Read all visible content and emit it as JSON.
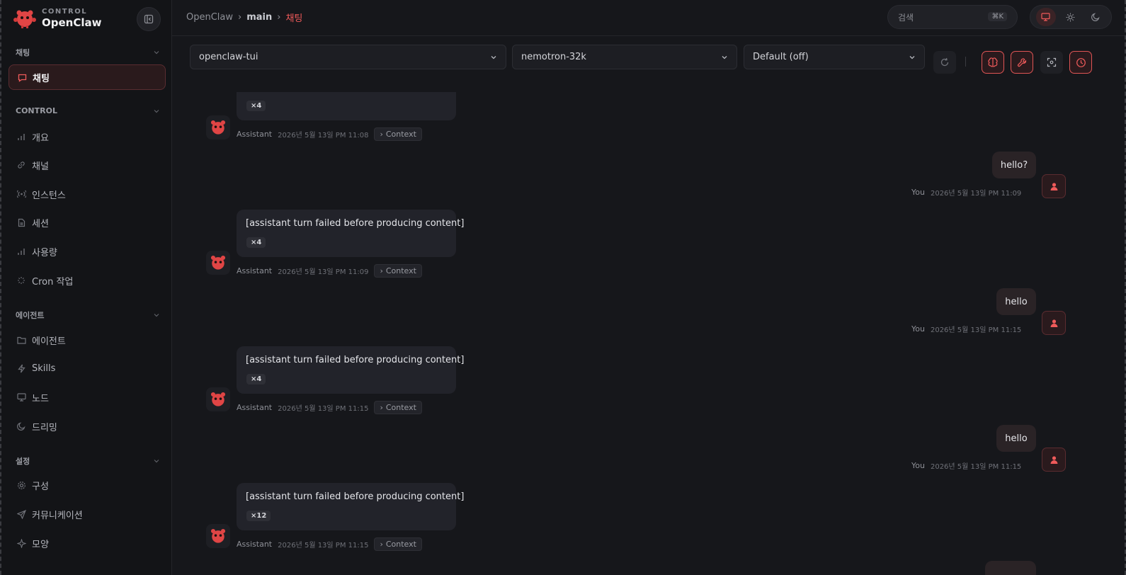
{
  "brand": {
    "subtitle": "CONTROL",
    "name": "OpenClaw"
  },
  "sidebar": {
    "sections": [
      {
        "label": "채팅"
      },
      {
        "label": "CONTROL"
      },
      {
        "label": "에이전트"
      },
      {
        "label": "설정"
      }
    ],
    "items": [
      {
        "label": "채팅",
        "icon": "chat-bubble-icon",
        "active": true
      },
      {
        "label": "개요",
        "icon": "bar-chart-icon"
      },
      {
        "label": "채널",
        "icon": "link-icon"
      },
      {
        "label": "인스턴스",
        "icon": "radio-icon"
      },
      {
        "label": "세션",
        "icon": "document-icon"
      },
      {
        "label": "사용량",
        "icon": "bar-chart-icon"
      },
      {
        "label": "Cron 작업",
        "icon": "loader-icon"
      },
      {
        "label": "에이전트",
        "icon": "folder-icon"
      },
      {
        "label": "Skills",
        "icon": "zap-icon"
      },
      {
        "label": "노드",
        "icon": "monitor-icon"
      },
      {
        "label": "드리밍",
        "icon": "moon-icon"
      },
      {
        "label": "구성",
        "icon": "gear-icon"
      },
      {
        "label": "커뮤니케이션",
        "icon": "send-icon"
      },
      {
        "label": "모양",
        "icon": "sparkle-icon"
      }
    ]
  },
  "header": {
    "breadcrumb": [
      "OpenClaw",
      "main",
      "채팅"
    ],
    "search_placeholder": "검색",
    "search_shortcut": "⌘K"
  },
  "toolbar": {
    "session": "openclaw-tui",
    "model": "nemotron-32k",
    "thinking": "Default (off)",
    "separator": "|"
  },
  "messages": [
    {
      "role": "assistant",
      "text": "",
      "count": "×4",
      "sender": "Assistant",
      "time": "2026년 5월 13일 PM 11:08",
      "context": "Context"
    },
    {
      "role": "user",
      "text": "hello?",
      "sender": "You",
      "time": "2026년 5월 13일 PM 11:09"
    },
    {
      "role": "assistant",
      "text": "[assistant turn failed before producing content]",
      "count": "×4",
      "sender": "Assistant",
      "time": "2026년 5월 13일 PM 11:09",
      "context": "Context"
    },
    {
      "role": "user",
      "text": "hello",
      "sender": "You",
      "time": "2026년 5월 13일 PM 11:15"
    },
    {
      "role": "assistant",
      "text": "[assistant turn failed before producing content]",
      "count": "×4",
      "sender": "Assistant",
      "time": "2026년 5월 13일 PM 11:15",
      "context": "Context"
    },
    {
      "role": "user",
      "text": "hello",
      "sender": "You",
      "time": "2026년 5월 13일 PM 11:15"
    },
    {
      "role": "assistant",
      "text": "[assistant turn failed before producing content]",
      "count": "×12",
      "sender": "Assistant",
      "time": "2026년 5월 13일 PM 11:15",
      "context": "Context"
    }
  ],
  "colors": {
    "accent": "#ef5a5a",
    "background": "#16171b",
    "sidebar": "#131417"
  }
}
